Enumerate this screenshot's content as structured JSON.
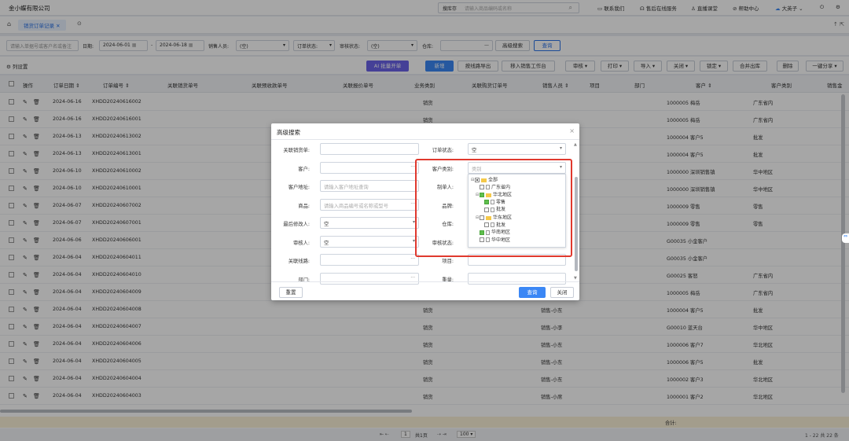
{
  "header": {
    "company": "金小蝶有限公司",
    "search_label": "搜库存",
    "search_placeholder": "请输入商品编码或名称",
    "links": [
      "联系我们",
      "售后在线服务",
      "直播课堂",
      "帮助中心",
      "大英子"
    ]
  },
  "tabs": {
    "home_icon": "home-icon",
    "active": "销货订单记录"
  },
  "filter": {
    "keyword_placeholder": "请输入单据号或客户名或备注",
    "date_label": "日期:",
    "date_from": "2024-06-01",
    "date_to": "2024-06-18",
    "sales_label": "销售人员:",
    "sales_value": "(空)",
    "order_status_label": "订单状态:",
    "order_status_value": "(空)",
    "audit_label": "审核状态:",
    "audit_value": "(空)",
    "warehouse_label": "仓库:",
    "adv_search": "高级搜索",
    "query": "查询"
  },
  "toolbar": {
    "column_settings": "列设置",
    "batch_open": "批量开单",
    "buttons": [
      "新增",
      "按线路导出",
      "移入销售工作台",
      "审核",
      "打印",
      "导入",
      "关闭",
      "锁定",
      "合并出库",
      "删除",
      "一键分享"
    ]
  },
  "grid": {
    "columns": [
      "操作",
      "订单日期",
      "订单编号",
      "关联销货单号",
      "关联预收款单号",
      "关联报价单号",
      "业务类别",
      "关联购货订单号",
      "销售人员",
      "项目",
      "部门",
      "客户",
      "客户类别",
      "销售金"
    ],
    "rows": [
      {
        "date": "2024-06-16",
        "no": "XHDD20240616002",
        "cat": "销货",
        "sales": "",
        "customer": "1000005 梅岳",
        "ctype": "广东省内"
      },
      {
        "date": "2024-06-16",
        "no": "XHDD20240616001",
        "cat": "销货",
        "sales": "",
        "customer": "1000005 梅岳",
        "ctype": "广东省内"
      },
      {
        "date": "2024-06-13",
        "no": "XHDD20240613002",
        "cat": "",
        "sales": "",
        "customer": "1000004 客户5",
        "ctype": "批发"
      },
      {
        "date": "2024-06-13",
        "no": "XHDD20240613001",
        "cat": "",
        "sales": "",
        "customer": "1000004 客户5",
        "ctype": "批发"
      },
      {
        "date": "2024-06-10",
        "no": "XHDD20240610002",
        "cat": "",
        "sales": "",
        "customer": "1000000 深圳销售镇",
        "ctype": "华中地区"
      },
      {
        "date": "2024-06-10",
        "no": "XHDD20240610001",
        "cat": "",
        "sales": "",
        "customer": "1000000 深圳销售镇",
        "ctype": "华中地区"
      },
      {
        "date": "2024-06-07",
        "no": "XHDD20240607002",
        "cat": "",
        "sales": "",
        "customer": "1000009 零售",
        "ctype": "零售"
      },
      {
        "date": "2024-06-07",
        "no": "XHDD20240607001",
        "cat": "",
        "sales": "",
        "customer": "1000009 零售",
        "ctype": "零售"
      },
      {
        "date": "2024-06-06",
        "no": "XHDD20240606001",
        "cat": "",
        "sales": "",
        "customer": "G00035 小金客户",
        "ctype": ""
      },
      {
        "date": "2024-06-04",
        "no": "XHDD20240604011",
        "cat": "",
        "sales": "",
        "customer": "G00035 小金客户",
        "ctype": ""
      },
      {
        "date": "2024-06-04",
        "no": "XHDD20240604010",
        "cat": "",
        "sales": "",
        "customer": "G00025 客怒",
        "ctype": "广东省内"
      },
      {
        "date": "2024-06-04",
        "no": "XHDD20240604009",
        "cat": "",
        "sales": "",
        "customer": "1000005 梅岳",
        "ctype": "广东省内"
      },
      {
        "date": "2024-06-04",
        "no": "XHDD20240604008",
        "cat": "销货",
        "sales": "销售-小东",
        "customer": "1000004 客户5",
        "ctype": "批发"
      },
      {
        "date": "2024-06-04",
        "no": "XHDD20240604007",
        "cat": "销货",
        "sales": "销售-小李",
        "customer": "G00010 蓝天台",
        "ctype": "华中地区"
      },
      {
        "date": "2024-06-04",
        "no": "XHDD20240604006",
        "cat": "销货",
        "sales": "销售-小东",
        "customer": "1000006 客户7",
        "ctype": "华北地区"
      },
      {
        "date": "2024-06-04",
        "no": "XHDD20240604005",
        "cat": "销货",
        "sales": "销售-小东",
        "customer": "1000006 客户5",
        "ctype": "批发"
      },
      {
        "date": "2024-06-04",
        "no": "XHDD20240604004",
        "cat": "销货",
        "sales": "销售-小东",
        "customer": "1000002 客户3",
        "ctype": "华北地区"
      },
      {
        "date": "2024-06-04",
        "no": "XHDD20240604003",
        "cat": "销货",
        "sales": "销售-小席",
        "customer": "1000001 客户2",
        "ctype": "华北地区"
      }
    ],
    "total_label": "合计:"
  },
  "pager": {
    "page": "1",
    "total_pages": "共1页",
    "page_size": "100",
    "summary": "1 - 22  共 22 条"
  },
  "dialog": {
    "title": "高级搜索",
    "fields_left": [
      {
        "label": "关联销货单:",
        "value": "",
        "placeholder": ""
      },
      {
        "label": "客户:",
        "value": "",
        "placeholder": "",
        "more": "···"
      },
      {
        "label": "客户地址:",
        "value": "",
        "placeholder": "请输入客户地址查询"
      },
      {
        "label": "商品:",
        "value": "",
        "placeholder": "请输入商品编号或名称或型号",
        "more": "···"
      },
      {
        "label": "最后修改人:",
        "value": "空",
        "placeholder": ""
      },
      {
        "label": "审核人:",
        "value": "空",
        "placeholder": ""
      },
      {
        "label": "关联线路:",
        "value": "",
        "placeholder": "",
        "more": "···"
      },
      {
        "label": "部门:",
        "value": "",
        "placeholder": "",
        "more": "···"
      }
    ],
    "fields_right": [
      {
        "label": "订单状态:",
        "value": "空"
      },
      {
        "label": "客户类别:",
        "value": "类别"
      },
      {
        "label": "制单人:",
        "value": ""
      },
      {
        "label": "品牌:",
        "value": ""
      },
      {
        "label": "仓库:",
        "value": ""
      },
      {
        "label": "审核状态:",
        "value": ""
      },
      {
        "label": "项目:",
        "value": ""
      },
      {
        "label": "重量:",
        "value": ""
      }
    ],
    "tree": [
      {
        "label": "全部",
        "level": 0,
        "type": "folder",
        "state": "part",
        "exp": "⊟"
      },
      {
        "label": "广东省内",
        "level": 1,
        "type": "doc",
        "state": "off",
        "exp": ""
      },
      {
        "label": "华北地区",
        "level": 1,
        "type": "folder",
        "state": "on",
        "exp": "⊟"
      },
      {
        "label": "零售",
        "level": 2,
        "type": "doc",
        "state": "on",
        "exp": ""
      },
      {
        "label": "批发",
        "level": 2,
        "type": "doc",
        "state": "off",
        "exp": ""
      },
      {
        "label": "华东地区",
        "level": 1,
        "type": "folder",
        "state": "off",
        "exp": "⊟"
      },
      {
        "label": "批发",
        "level": 2,
        "type": "doc",
        "state": "off",
        "exp": ""
      },
      {
        "label": "华南地区",
        "level": 1,
        "type": "doc",
        "state": "on",
        "exp": ""
      },
      {
        "label": "华中地区",
        "level": 1,
        "type": "doc",
        "state": "off",
        "exp": ""
      }
    ],
    "reset": "重置",
    "query": "查询",
    "close": "关闭"
  }
}
